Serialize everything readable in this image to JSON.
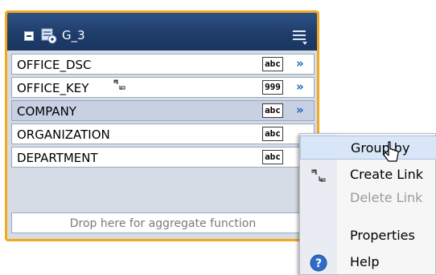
{
  "group": {
    "name": "G_3",
    "fields": [
      {
        "label": "OFFICE_DSC",
        "type_badge": "abc",
        "has_key_icon": false,
        "selected": false
      },
      {
        "label": "OFFICE_KEY",
        "type_badge": "999",
        "has_key_icon": true,
        "selected": false
      },
      {
        "label": "COMPANY",
        "type_badge": "abc",
        "has_key_icon": false,
        "selected": true
      },
      {
        "label": "ORGANIZATION",
        "type_badge": "abc",
        "has_key_icon": false,
        "selected": false
      },
      {
        "label": "DEPARTMENT",
        "type_badge": "abc",
        "has_key_icon": false,
        "selected": false
      }
    ],
    "expand_glyph": "»",
    "drop_zone_text": "Drop here for aggregate function"
  },
  "context_menu": {
    "items": [
      {
        "label": "Group by",
        "icon": "",
        "enabled": true,
        "hovered": true
      },
      {
        "label": "Create Link",
        "icon": "link-icon",
        "enabled": true,
        "hovered": false
      },
      {
        "label": "Delete Link",
        "icon": "",
        "enabled": false,
        "hovered": false
      },
      {
        "label": "Properties",
        "icon": "",
        "enabled": true,
        "hovered": false
      },
      {
        "label": "Help",
        "icon": "help-icon",
        "enabled": true,
        "hovered": false
      }
    ]
  },
  "colors": {
    "header": "#1f3d6b",
    "panel_border": "#f3a81e",
    "selected_row": "#c8d1e3",
    "expand_arrow": "#1565c0"
  }
}
